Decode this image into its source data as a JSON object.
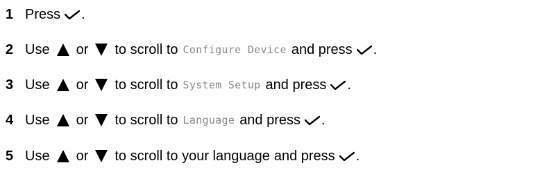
{
  "steps": [
    {
      "number": "1",
      "press": "Press",
      "end": "."
    },
    {
      "number": "2",
      "use": "Use",
      "or": "or",
      "scroll": "to scroll to",
      "menu": "Configure Device",
      "and_press": "and press",
      "end": "."
    },
    {
      "number": "3",
      "use": "Use",
      "or": "or",
      "scroll": "to scroll to",
      "menu": "System Setup",
      "and_press": "and press",
      "end": "."
    },
    {
      "number": "4",
      "use": "Use",
      "or": "or",
      "scroll": "to scroll to",
      "menu": "Language",
      "and_press": "and press",
      "end": "."
    },
    {
      "number": "5",
      "use": "Use",
      "or": "or",
      "scroll": "to scroll to your language",
      "and_press": "and press",
      "end": "."
    }
  ],
  "icons": {
    "select": "checkmark-icon",
    "up": "up-arrow-icon",
    "down": "down-arrow-icon"
  }
}
